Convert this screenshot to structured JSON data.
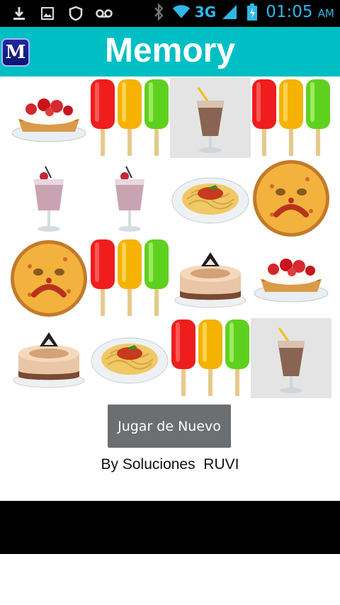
{
  "status_bar": {
    "time": "01:05",
    "ampm": "AM",
    "network": "3G",
    "icons": [
      "download-icon",
      "image-icon",
      "shield-icon",
      "voicemail-icon",
      "bluetooth-icon",
      "wifi-icon",
      "signal-icon",
      "battery-icon"
    ]
  },
  "app": {
    "icon_letter": "M",
    "title": "Memory"
  },
  "board": {
    "rows": [
      [
        "tart",
        "popsicles",
        "milkshake",
        "popsicles"
      ],
      [
        "smoothie",
        "smoothie",
        "spaghetti",
        "pizza"
      ],
      [
        "pizza",
        "popsicles",
        "cake",
        "tart"
      ],
      [
        "cake",
        "spaghetti",
        "popsicles",
        "milkshake"
      ]
    ]
  },
  "actions": {
    "play_again_label": "Jugar de Nuevo"
  },
  "footer": {
    "credit": "By Soluciones  RUVI"
  }
}
